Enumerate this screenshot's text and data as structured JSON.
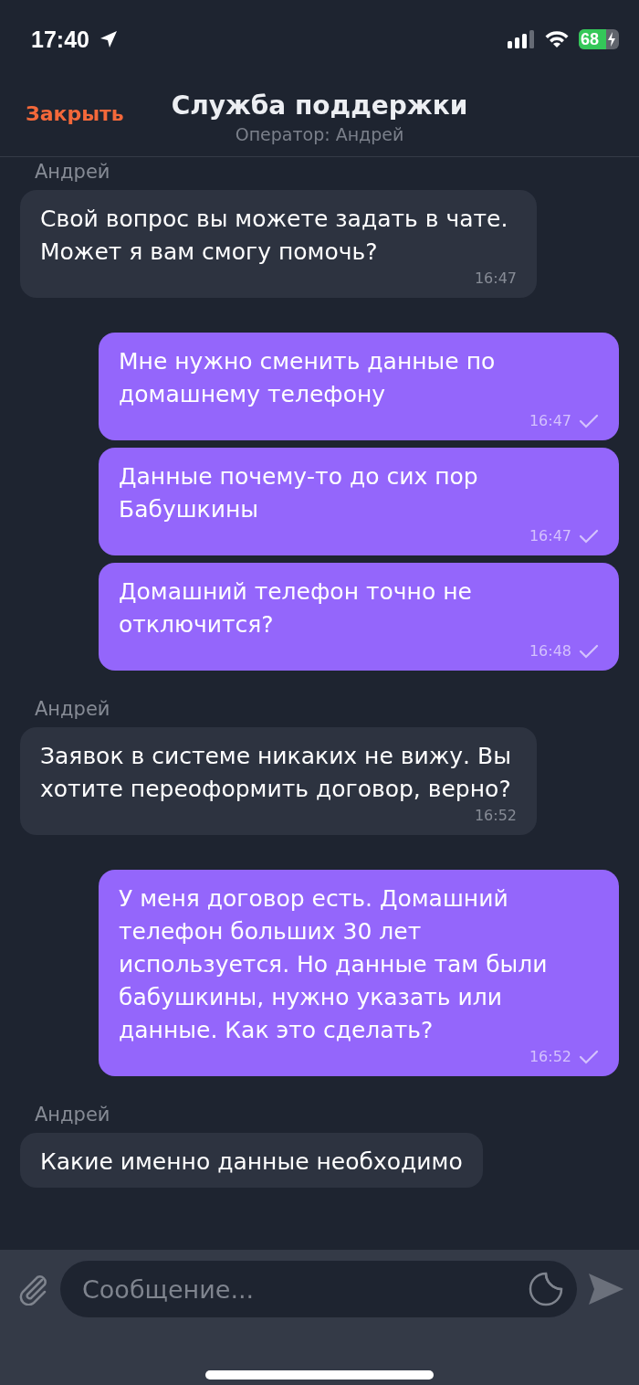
{
  "status_bar": {
    "time": "17:40",
    "battery": "68"
  },
  "header": {
    "close": "Закрыть",
    "title": "Служба поддержки",
    "subtitle": "Оператор: Андрей"
  },
  "messages": [
    {
      "kind": "incoming",
      "sender": "Андрей",
      "text": "Свой вопрос вы можете задать в чате. Может я вам смогу помочь?",
      "time": "16:47"
    },
    {
      "kind": "outgoing",
      "text": "Мне нужно сменить данные по домашнему телефону",
      "time": "16:47",
      "delivered": true
    },
    {
      "kind": "outgoing",
      "text": "Данные почему-то до сих пор Бабушкины",
      "time": "16:47",
      "delivered": true
    },
    {
      "kind": "outgoing",
      "text": "Домашний телефон точно не отключится?",
      "time": "16:48",
      "delivered": true
    },
    {
      "kind": "incoming",
      "sender": "Андрей",
      "text": "Заявок в системе никаких не вижу. Вы хотите переоформить договор, верно?",
      "time": "16:52"
    },
    {
      "kind": "outgoing",
      "text": "У меня договор есть. Домашний телефон больших 30 лет используется. Но данные там были бабушкины, нужно указать или данные. Как это сделать?",
      "time": "16:52",
      "delivered": true
    },
    {
      "kind": "incoming",
      "sender": "Андрей",
      "text": "Какие именно данные необходимо"
    }
  ],
  "composer": {
    "placeholder": "Сообщение..."
  }
}
